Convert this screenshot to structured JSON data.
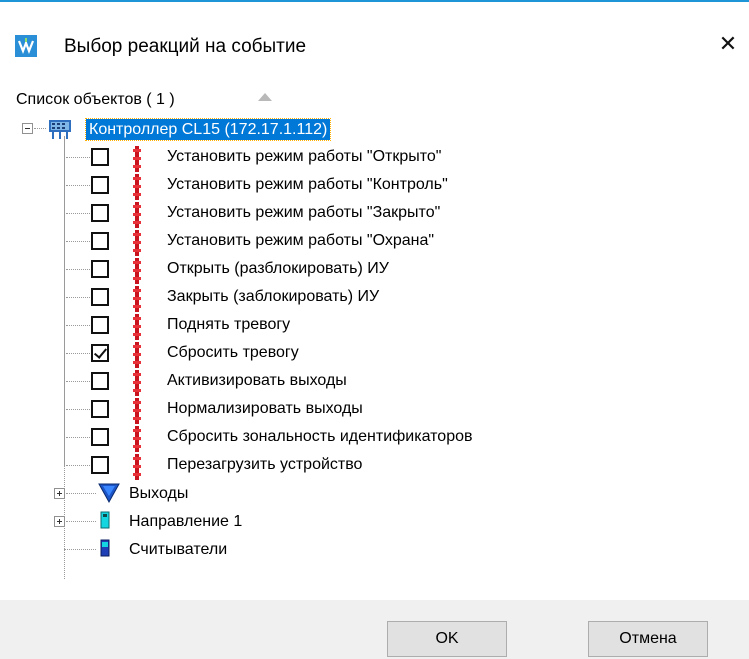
{
  "window": {
    "title": "Выбор реакций на событие",
    "close_symbol": "✕",
    "accent": "#1e95d6"
  },
  "list": {
    "header": "Список объектов ( 1 )",
    "sort_icon": "sort-ascending-icon"
  },
  "tree": {
    "controller": {
      "label": "Контроллер CL15 (172.17.1.112)",
      "selected": true,
      "icon": "controller-icon"
    },
    "actions": [
      {
        "label": "Установить режим работы \"Открыто\"",
        "checked": false
      },
      {
        "label": "Установить режим работы \"Контроль\"",
        "checked": false
      },
      {
        "label": "Установить режим работы \"Закрыто\"",
        "checked": false
      },
      {
        "label": "Установить режим работы \"Охрана\"",
        "checked": false
      },
      {
        "label": "Открыть (разблокировать) ИУ",
        "checked": false
      },
      {
        "label": "Закрыть (заблокировать) ИУ",
        "checked": false
      },
      {
        "label": "Поднять тревогу",
        "checked": false
      },
      {
        "label": "Сбросить тревогу",
        "checked": true
      },
      {
        "label": "Активизировать выходы",
        "checked": false
      },
      {
        "label": "Нормализировать выходы",
        "checked": false
      },
      {
        "label": "Сбросить зональность идентификаторов",
        "checked": false
      },
      {
        "label": "Перезагрузить устройство",
        "checked": false
      }
    ],
    "children": [
      {
        "label": "Выходы",
        "icon": "outputs-icon",
        "expandable": true
      },
      {
        "label": "Направление 1",
        "icon": "direction-icon",
        "expandable": true
      },
      {
        "label": "Считыватели",
        "icon": "readers-icon",
        "expandable": false
      }
    ]
  },
  "buttons": {
    "ok": "OK",
    "cancel": "Отмена"
  }
}
